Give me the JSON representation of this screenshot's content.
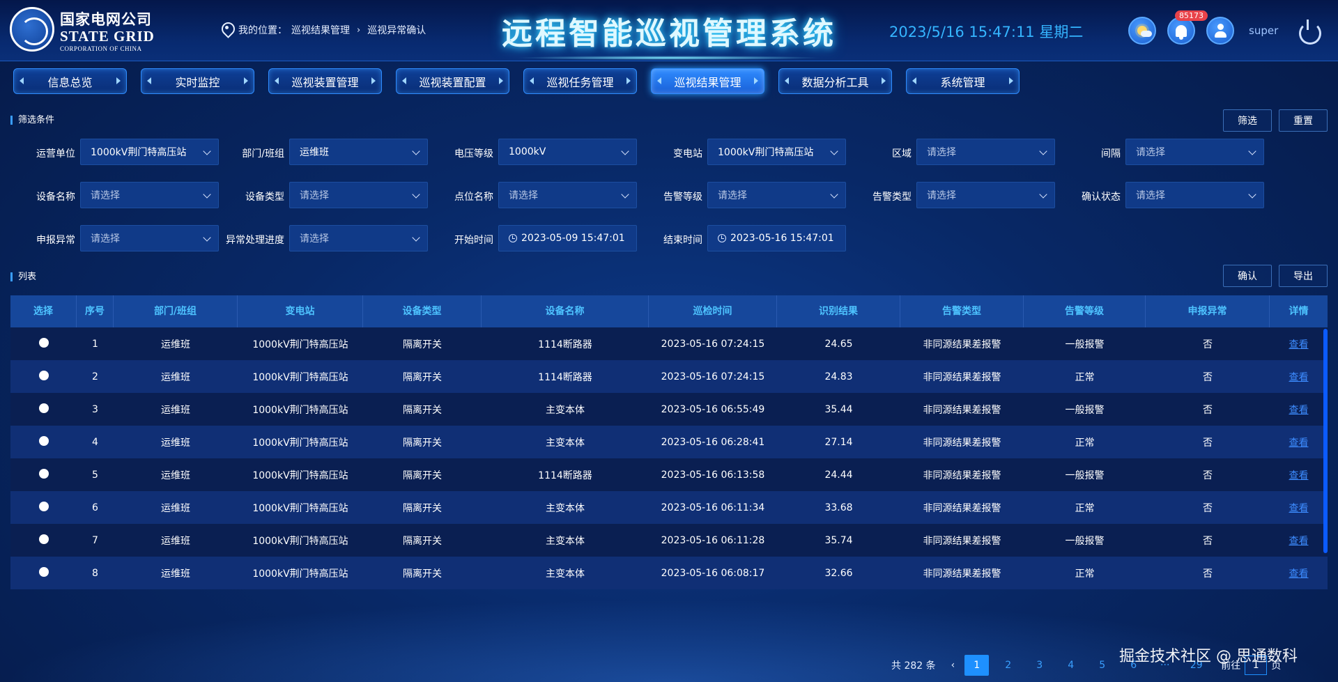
{
  "header": {
    "logo_cn": "国家电网公司",
    "logo_en1": "STATE GRID",
    "logo_en2": "CORPORATION OF CHINA",
    "location_prefix": "我的位置：",
    "breadcrumb": [
      "巡视结果管理",
      "巡视异常确认"
    ],
    "title": "远程智能巡视管理系统",
    "datetime": "2023/5/16 15:47:11 星期二",
    "notification_count": "85173",
    "username": "super"
  },
  "nav": {
    "tabs": [
      {
        "label": "信息总览",
        "active": false
      },
      {
        "label": "实时监控",
        "active": false
      },
      {
        "label": "巡视装置管理",
        "active": false
      },
      {
        "label": "巡视装置配置",
        "active": false
      },
      {
        "label": "巡视任务管理",
        "active": false
      },
      {
        "label": "巡视结果管理",
        "active": true
      },
      {
        "label": "数据分析工具",
        "active": false
      },
      {
        "label": "系统管理",
        "active": false
      }
    ]
  },
  "filters": {
    "section_title": "筛选条件",
    "filter_button": "筛选",
    "reset_button": "重置",
    "fields": [
      {
        "label": "运营单位",
        "value": "1000kV荆门特高压站",
        "placeholder": false
      },
      {
        "label": "部门/班组",
        "value": "运维班",
        "placeholder": false
      },
      {
        "label": "电压等级",
        "value": "1000kV",
        "placeholder": false
      },
      {
        "label": "变电站",
        "value": "1000kV荆门特高压站",
        "placeholder": false
      },
      {
        "label": "区域",
        "value": "请选择",
        "placeholder": true
      },
      {
        "label": "间隔",
        "value": "请选择",
        "placeholder": true
      },
      {
        "label": "设备名称",
        "value": "请选择",
        "placeholder": true
      },
      {
        "label": "设备类型",
        "value": "请选择",
        "placeholder": true
      },
      {
        "label": "点位名称",
        "value": "请选择",
        "placeholder": true
      },
      {
        "label": "告警等级",
        "value": "请选择",
        "placeholder": true
      },
      {
        "label": "告警类型",
        "value": "请选择",
        "placeholder": true
      },
      {
        "label": "确认状态",
        "value": "请选择",
        "placeholder": true
      },
      {
        "label": "申报异常",
        "value": "请选择",
        "placeholder": true
      },
      {
        "label": "异常处理进度",
        "value": "请选择",
        "placeholder": true
      }
    ],
    "start_label": "开始时间",
    "start_value": "2023-05-09 15:47:01",
    "end_label": "结束时间",
    "end_value": "2023-05-16 15:47:01"
  },
  "list": {
    "section_title": "列表",
    "confirm_button": "确认",
    "export_button": "导出",
    "columns": [
      "选择",
      "序号",
      "部门/班组",
      "变电站",
      "设备类型",
      "设备名称",
      "巡检时间",
      "识别结果",
      "告警类型",
      "告警等级",
      "申报异常",
      "详情"
    ],
    "rows": [
      [
        "1",
        "运维班",
        "1000kV荆门特高压站",
        "隔离开关",
        "1114断路器",
        "2023-05-16 07:24:15",
        "24.65",
        "非同源结果差报警",
        "一般报警",
        "否",
        "查看"
      ],
      [
        "2",
        "运维班",
        "1000kV荆门特高压站",
        "隔离开关",
        "1114断路器",
        "2023-05-16 07:24:15",
        "24.83",
        "非同源结果差报警",
        "正常",
        "否",
        "查看"
      ],
      [
        "3",
        "运维班",
        "1000kV荆门特高压站",
        "隔离开关",
        "主变本体",
        "2023-05-16 06:55:49",
        "35.44",
        "非同源结果差报警",
        "一般报警",
        "否",
        "查看"
      ],
      [
        "4",
        "运维班",
        "1000kV荆门特高压站",
        "隔离开关",
        "主变本体",
        "2023-05-16 06:28:41",
        "27.14",
        "非同源结果差报警",
        "正常",
        "否",
        "查看"
      ],
      [
        "5",
        "运维班",
        "1000kV荆门特高压站",
        "隔离开关",
        "1114断路器",
        "2023-05-16 06:13:58",
        "24.44",
        "非同源结果差报警",
        "一般报警",
        "否",
        "查看"
      ],
      [
        "6",
        "运维班",
        "1000kV荆门特高压站",
        "隔离开关",
        "主变本体",
        "2023-05-16 06:11:34",
        "33.68",
        "非同源结果差报警",
        "正常",
        "否",
        "查看"
      ],
      [
        "7",
        "运维班",
        "1000kV荆门特高压站",
        "隔离开关",
        "主变本体",
        "2023-05-16 06:11:28",
        "35.74",
        "非同源结果差报警",
        "一般报警",
        "否",
        "查看"
      ],
      [
        "8",
        "运维班",
        "1000kV荆门特高压站",
        "隔离开关",
        "主变本体",
        "2023-05-16 06:08:17",
        "32.66",
        "非同源结果差报警",
        "正常",
        "否",
        "查看"
      ]
    ]
  },
  "pagination": {
    "total": "共 282 条",
    "prev": "‹",
    "pages": [
      "1",
      "2",
      "3",
      "4",
      "5",
      "6"
    ],
    "ellipsis": "···",
    "last": "29",
    "goto_prefix": "前往",
    "goto_value": "1",
    "goto_suffix": "页"
  },
  "watermark": "掘金技术社区 @ 思通数科",
  "colors": {
    "accent": "#1e90ff",
    "header_text": "#4ec3ff",
    "link": "#3d8cff",
    "badge": "#e8434a"
  }
}
